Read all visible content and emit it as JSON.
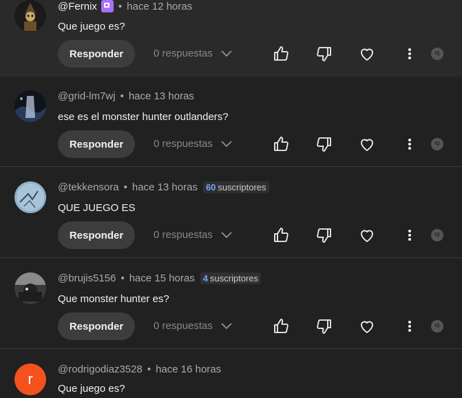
{
  "comments": [
    {
      "username": "@Fernix",
      "time": "hace 12 horas",
      "text": "Que juego es?",
      "subs_count": "",
      "subs_label": ""
    },
    {
      "username": "@grid-lm7wj",
      "time": "hace 13 horas",
      "text": "ese es el monster hunter outlanders?",
      "subs_count": "",
      "subs_label": ""
    },
    {
      "username": "@tekkensora",
      "time": "hace 13 horas",
      "text": "QUE JUEGO ES",
      "subs_count": "60",
      "subs_label": "suscriptores"
    },
    {
      "username": "@brujis5156",
      "time": "hace 15 horas",
      "text": "Que monster hunter es?",
      "subs_count": "4",
      "subs_label": "suscriptores"
    },
    {
      "username": "@rodrigodiaz3528",
      "time": "hace 16 horas",
      "text": "Que juego es?",
      "avatar_letter": "r"
    }
  ],
  "actions": {
    "reply_label": "Responder",
    "replies_label": "0 respuestas",
    "separator": "•",
    "small_icon_text": "IQ"
  },
  "icons": {
    "like": "thumbs-up-icon",
    "dislike": "thumbs-down-icon",
    "heart": "heart-icon",
    "more": "more-vertical-icon",
    "chevron": "chevron-down-icon"
  },
  "colors": {
    "background": "#212121",
    "highlight_background": "#2a2a2a",
    "twitch_badge": "#a970ff",
    "avatar_letter_bg": "#f4511e"
  }
}
